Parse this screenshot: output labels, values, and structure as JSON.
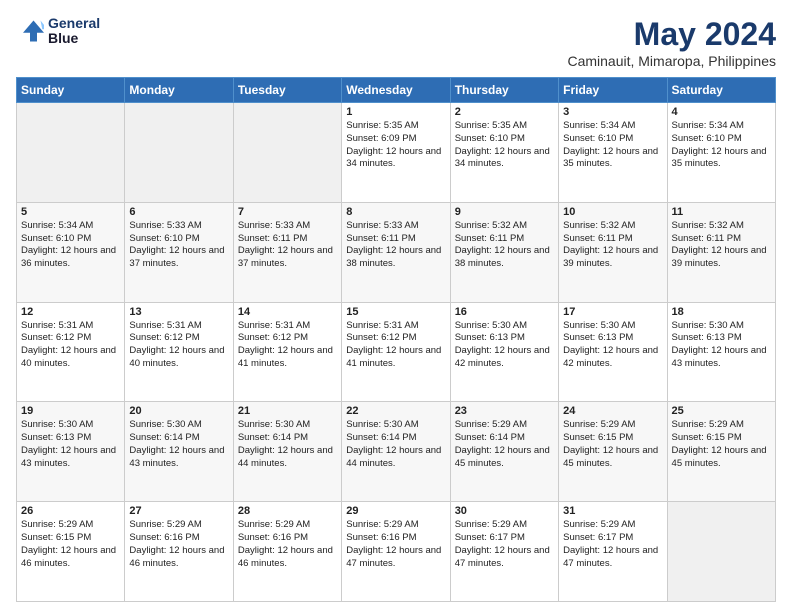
{
  "header": {
    "logo_line1": "General",
    "logo_line2": "Blue",
    "title": "May 2024",
    "subtitle": "Caminauit, Mimaropa, Philippines"
  },
  "weekdays": [
    "Sunday",
    "Monday",
    "Tuesday",
    "Wednesday",
    "Thursday",
    "Friday",
    "Saturday"
  ],
  "weeks": [
    [
      {
        "day": "",
        "info": ""
      },
      {
        "day": "",
        "info": ""
      },
      {
        "day": "",
        "info": ""
      },
      {
        "day": "1",
        "info": "Sunrise: 5:35 AM\nSunset: 6:09 PM\nDaylight: 12 hours\nand 34 minutes."
      },
      {
        "day": "2",
        "info": "Sunrise: 5:35 AM\nSunset: 6:10 PM\nDaylight: 12 hours\nand 34 minutes."
      },
      {
        "day": "3",
        "info": "Sunrise: 5:34 AM\nSunset: 6:10 PM\nDaylight: 12 hours\nand 35 minutes."
      },
      {
        "day": "4",
        "info": "Sunrise: 5:34 AM\nSunset: 6:10 PM\nDaylight: 12 hours\nand 35 minutes."
      }
    ],
    [
      {
        "day": "5",
        "info": "Sunrise: 5:34 AM\nSunset: 6:10 PM\nDaylight: 12 hours\nand 36 minutes."
      },
      {
        "day": "6",
        "info": "Sunrise: 5:33 AM\nSunset: 6:10 PM\nDaylight: 12 hours\nand 37 minutes."
      },
      {
        "day": "7",
        "info": "Sunrise: 5:33 AM\nSunset: 6:11 PM\nDaylight: 12 hours\nand 37 minutes."
      },
      {
        "day": "8",
        "info": "Sunrise: 5:33 AM\nSunset: 6:11 PM\nDaylight: 12 hours\nand 38 minutes."
      },
      {
        "day": "9",
        "info": "Sunrise: 5:32 AM\nSunset: 6:11 PM\nDaylight: 12 hours\nand 38 minutes."
      },
      {
        "day": "10",
        "info": "Sunrise: 5:32 AM\nSunset: 6:11 PM\nDaylight: 12 hours\nand 39 minutes."
      },
      {
        "day": "11",
        "info": "Sunrise: 5:32 AM\nSunset: 6:11 PM\nDaylight: 12 hours\nand 39 minutes."
      }
    ],
    [
      {
        "day": "12",
        "info": "Sunrise: 5:31 AM\nSunset: 6:12 PM\nDaylight: 12 hours\nand 40 minutes."
      },
      {
        "day": "13",
        "info": "Sunrise: 5:31 AM\nSunset: 6:12 PM\nDaylight: 12 hours\nand 40 minutes."
      },
      {
        "day": "14",
        "info": "Sunrise: 5:31 AM\nSunset: 6:12 PM\nDaylight: 12 hours\nand 41 minutes."
      },
      {
        "day": "15",
        "info": "Sunrise: 5:31 AM\nSunset: 6:12 PM\nDaylight: 12 hours\nand 41 minutes."
      },
      {
        "day": "16",
        "info": "Sunrise: 5:30 AM\nSunset: 6:13 PM\nDaylight: 12 hours\nand 42 minutes."
      },
      {
        "day": "17",
        "info": "Sunrise: 5:30 AM\nSunset: 6:13 PM\nDaylight: 12 hours\nand 42 minutes."
      },
      {
        "day": "18",
        "info": "Sunrise: 5:30 AM\nSunset: 6:13 PM\nDaylight: 12 hours\nand 43 minutes."
      }
    ],
    [
      {
        "day": "19",
        "info": "Sunrise: 5:30 AM\nSunset: 6:13 PM\nDaylight: 12 hours\nand 43 minutes."
      },
      {
        "day": "20",
        "info": "Sunrise: 5:30 AM\nSunset: 6:14 PM\nDaylight: 12 hours\nand 43 minutes."
      },
      {
        "day": "21",
        "info": "Sunrise: 5:30 AM\nSunset: 6:14 PM\nDaylight: 12 hours\nand 44 minutes."
      },
      {
        "day": "22",
        "info": "Sunrise: 5:30 AM\nSunset: 6:14 PM\nDaylight: 12 hours\nand 44 minutes."
      },
      {
        "day": "23",
        "info": "Sunrise: 5:29 AM\nSunset: 6:14 PM\nDaylight: 12 hours\nand 45 minutes."
      },
      {
        "day": "24",
        "info": "Sunrise: 5:29 AM\nSunset: 6:15 PM\nDaylight: 12 hours\nand 45 minutes."
      },
      {
        "day": "25",
        "info": "Sunrise: 5:29 AM\nSunset: 6:15 PM\nDaylight: 12 hours\nand 45 minutes."
      }
    ],
    [
      {
        "day": "26",
        "info": "Sunrise: 5:29 AM\nSunset: 6:15 PM\nDaylight: 12 hours\nand 46 minutes."
      },
      {
        "day": "27",
        "info": "Sunrise: 5:29 AM\nSunset: 6:16 PM\nDaylight: 12 hours\nand 46 minutes."
      },
      {
        "day": "28",
        "info": "Sunrise: 5:29 AM\nSunset: 6:16 PM\nDaylight: 12 hours\nand 46 minutes."
      },
      {
        "day": "29",
        "info": "Sunrise: 5:29 AM\nSunset: 6:16 PM\nDaylight: 12 hours\nand 47 minutes."
      },
      {
        "day": "30",
        "info": "Sunrise: 5:29 AM\nSunset: 6:17 PM\nDaylight: 12 hours\nand 47 minutes."
      },
      {
        "day": "31",
        "info": "Sunrise: 5:29 AM\nSunset: 6:17 PM\nDaylight: 12 hours\nand 47 minutes."
      },
      {
        "day": "",
        "info": ""
      }
    ]
  ]
}
